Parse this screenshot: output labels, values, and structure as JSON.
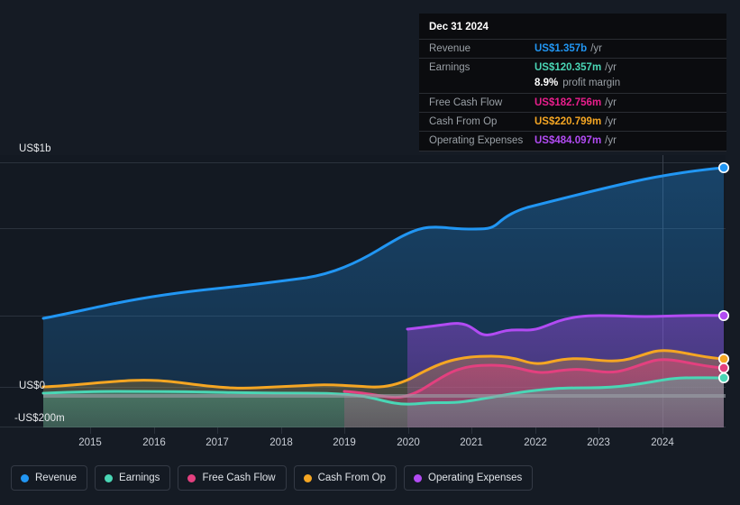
{
  "theme": {
    "background": "#151b24",
    "plot_background": "#131922",
    "grid_color": "#2b323c",
    "axis_text": "#e8eaed",
    "baseline_color": "#9aa0a6"
  },
  "yaxis": {
    "top_label": "US$1b",
    "zero_label": "US$0",
    "bottom_label": "-US$200m"
  },
  "xaxis": {
    "labels": [
      "2015",
      "2016",
      "2017",
      "2018",
      "2019",
      "2020",
      "2021",
      "2022",
      "2023",
      "2024"
    ]
  },
  "tooltip": {
    "date": "Dec 31 2024",
    "rows": [
      {
        "label": "Revenue",
        "value": "US$1.357b",
        "unit": "/yr",
        "color": "#2196f3"
      },
      {
        "label": "Earnings",
        "value": "US$120.357m",
        "unit": "/yr",
        "color": "#4ad6b5"
      },
      {
        "label": "",
        "value": "8.9%",
        "unit": "",
        "sub": "profit margin",
        "color": "#ffffff"
      },
      {
        "label": "Free Cash Flow",
        "value": "US$182.756m",
        "unit": "/yr",
        "color": "#e91e8c"
      },
      {
        "label": "Cash From Op",
        "value": "US$220.799m",
        "unit": "/yr",
        "color": "#f5a623"
      },
      {
        "label": "Operating Expenses",
        "value": "US$484.097m",
        "unit": "/yr",
        "color": "#b24bf3"
      }
    ]
  },
  "legend": {
    "items": [
      {
        "label": "Revenue",
        "color": "#2196f3"
      },
      {
        "label": "Earnings",
        "color": "#4ad6b5"
      },
      {
        "label": "Free Cash Flow",
        "color": "#e3407f"
      },
      {
        "label": "Cash From Op",
        "color": "#f5a623"
      },
      {
        "label": "Operating Expenses",
        "color": "#b24bf3"
      }
    ]
  },
  "chart_data": {
    "type": "area",
    "title": "",
    "xlabel": "",
    "ylabel": "",
    "ylim": [
      -200,
      1000
    ],
    "yunit": "US$ millions",
    "grid": true,
    "legend_position": "bottom",
    "x": [
      2014.6,
      2015,
      2016,
      2017,
      2018,
      2019,
      2020,
      2021,
      2022,
      2023,
      2024
    ],
    "xlim": [
      2014.6,
      2024.95
    ],
    "series": [
      {
        "name": "Revenue",
        "color": "#2196f3",
        "values": [
          300,
          340,
          400,
          450,
          490,
          610,
          710,
          720,
          880,
          1060,
          1357
        ]
      },
      {
        "name": "Earnings",
        "color": "#4ad6b5",
        "values": [
          22,
          25,
          28,
          30,
          30,
          25,
          -38,
          -22,
          18,
          55,
          120.357
        ]
      },
      {
        "name": "Free Cash Flow",
        "color": "#e3407f",
        "start_x": 2018.4,
        "values": [
          null,
          null,
          null,
          null,
          5,
          -10,
          60,
          140,
          120,
          150,
          182.756
        ]
      },
      {
        "name": "Cash From Op",
        "color": "#f5a623",
        "values": [
          48,
          55,
          70,
          62,
          55,
          50,
          100,
          165,
          145,
          180,
          220.799
        ]
      },
      {
        "name": "Operating Expenses",
        "color": "#b24bf3",
        "start_x": 2020.0,
        "values": [
          null,
          null,
          null,
          null,
          null,
          null,
          430,
          400,
          420,
          455,
          484.097
        ]
      }
    ],
    "endpoint_markers": [
      {
        "name": "Revenue",
        "value": 1357,
        "color": "#2196f3"
      },
      {
        "name": "Operating Expenses",
        "value": 484.097,
        "color": "#b24bf3"
      },
      {
        "name": "Cash From Op",
        "value": 220.799,
        "color": "#f5a623"
      },
      {
        "name": "Free Cash Flow",
        "value": 182.756,
        "color": "#e3407f"
      },
      {
        "name": "Earnings",
        "value": 120.357,
        "color": "#4ad6b5"
      }
    ]
  }
}
